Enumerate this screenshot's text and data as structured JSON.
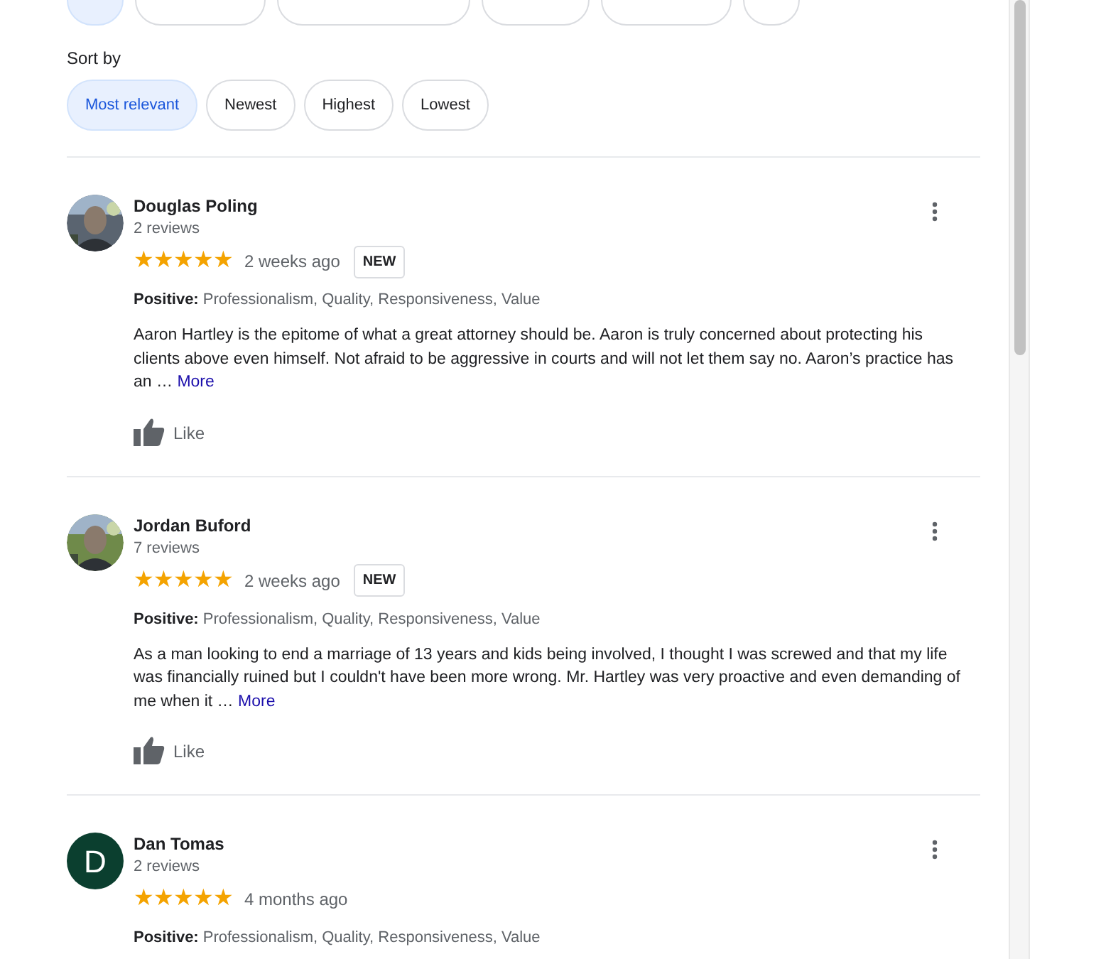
{
  "topic_chips": [
    {
      "selected": true
    },
    {
      "selected": false
    },
    {
      "selected": false
    },
    {
      "selected": false
    },
    {
      "selected": false
    },
    {
      "selected": false
    }
  ],
  "sort": {
    "label": "Sort by",
    "options": [
      {
        "label": "Most relevant",
        "selected": true
      },
      {
        "label": "Newest",
        "selected": false
      },
      {
        "label": "Highest",
        "selected": false
      },
      {
        "label": "Lowest",
        "selected": false
      }
    ]
  },
  "reviews": [
    {
      "name": "Douglas Poling",
      "count": "2 reviews",
      "stars": 5,
      "time": "2 weeks ago",
      "badge": "NEW",
      "positive_label": "Positive:",
      "positive": "Professionalism, Quality, Responsiveness, Value",
      "text": "Aaron Hartley is the epitome of what a great attorney should be. Aaron is truly concerned about protecting his clients above even himself.  Not afraid to be aggressive in courts and will not let them say no. Aaron’s practice has an …",
      "more": "More",
      "like": "Like"
    },
    {
      "name": "Jordan Buford",
      "count": "7 reviews",
      "stars": 5,
      "time": "2 weeks ago",
      "badge": "NEW",
      "positive_label": "Positive:",
      "positive": "Professionalism, Quality, Responsiveness, Value",
      "text": "As a man looking to end a marriage of 13 years and kids being involved, I thought I was screwed and that my life was financially ruined but I couldn't have been more wrong. Mr. Hartley was very proactive and even demanding of me when it …",
      "more": "More",
      "like": "Like"
    },
    {
      "avatar": {
        "kind": "letter",
        "letter": "D",
        "color": "#0b3f2f"
      },
      "name": "Dan Tomas",
      "count": "2 reviews",
      "stars": 5,
      "time": "4 months ago",
      "positive_label": "Positive:",
      "positive": "Professionalism, Quality, Responsiveness, Value"
    }
  ]
}
